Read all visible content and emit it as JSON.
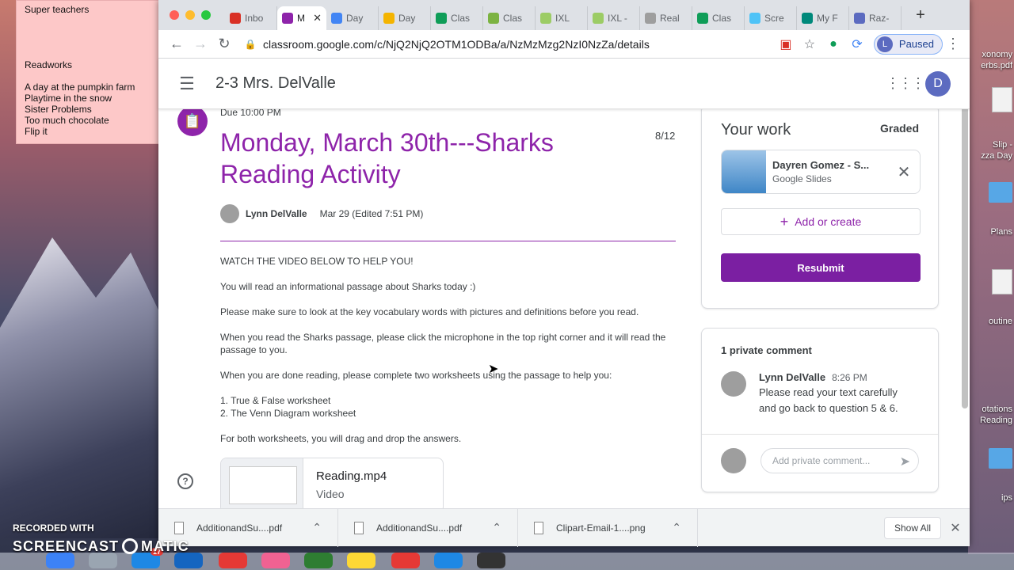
{
  "sticky": {
    "lines": [
      "Super teachers",
      "",
      "",
      "",
      "",
      "Readworks",
      "",
      "A day at the pumpkin farm",
      "Playtime in the snow",
      "Sister Problems",
      "Too much chocolate",
      "Flip it"
    ]
  },
  "desktop": {
    "icons": [
      "xonomy",
      "erbs.pdf",
      "Slip -",
      "zza Day",
      "Plans",
      "outine",
      "otations",
      "Reading",
      "ips"
    ]
  },
  "tabs": [
    {
      "label": "Inbo",
      "color": "#d93025"
    },
    {
      "label": "M",
      "color": "#8e24aa",
      "active": true
    },
    {
      "label": "Day",
      "color": "#4285f4"
    },
    {
      "label": "Day",
      "color": "#f4b400"
    },
    {
      "label": "Clas",
      "color": "#0f9d58"
    },
    {
      "label": "Clas",
      "color": "#7cb342"
    },
    {
      "label": "IXL",
      "color": "#9ccc65"
    },
    {
      "label": "IXL -",
      "color": "#9ccc65"
    },
    {
      "label": "Real",
      "color": "#9e9e9e"
    },
    {
      "label": "Clas",
      "color": "#0f9d58"
    },
    {
      "label": "Scre",
      "color": "#4fc3f7"
    },
    {
      "label": "My F",
      "color": "#00897b"
    },
    {
      "label": "Raz-",
      "color": "#5c6bc0"
    }
  ],
  "address": {
    "url": "classroom.google.com/c/NjQ2NjQ2OTM1ODBa/a/NzMzMzg2NzI0NzZa/details",
    "profile_initial": "L",
    "profile_status": "Paused"
  },
  "app": {
    "class_title": "2-3 Mrs. DelValle",
    "user_initial": "D"
  },
  "assignment": {
    "due": "Due 10:00 PM",
    "title": "Monday, March 30th---Sharks Reading Activity",
    "points": "8/12",
    "author": "Lynn DelValle",
    "date": "Mar 29 (Edited 7:51 PM)",
    "body": [
      "WATCH THE VIDEO BELOW TO HELP YOU!",
      "You will read an informational passage about Sharks today :)",
      "Please make sure to look at the key vocabulary words with pictures and definitions before you read.",
      "When you read the Sharks passage, please click the microphone in the top right corner and it will read the passage to you.",
      "When you are done reading, please complete two worksheets using the passage to help you:",
      "1. True & False worksheet\n2. The Venn Diagram worksheet",
      "For both worksheets, you will drag and drop the answers."
    ],
    "attachment": {
      "name": "Reading.mp4",
      "type": "Video"
    }
  },
  "your_work": {
    "heading": "Your work",
    "status": "Graded",
    "file": {
      "name": "Dayren Gomez - S...",
      "type": "Google Slides"
    },
    "add_label": "Add or create",
    "resubmit_label": "Resubmit"
  },
  "comments": {
    "heading": "1 private comment",
    "author": "Lynn DelValle",
    "time": "8:26 PM",
    "text": "Please read your text carefully and go back to question 5 & 6.",
    "placeholder": "Add private comment..."
  },
  "downloads": {
    "items": [
      "AdditionandSu....pdf",
      "AdditionandSu....pdf",
      "Clipart-Email-1....png"
    ],
    "show_all": "Show All"
  },
  "watermark": {
    "recorded": "RECORDED WITH",
    "brand_a": "SCREENCAST",
    "brand_b": "MATIC"
  },
  "dock": {
    "badge": "17"
  }
}
